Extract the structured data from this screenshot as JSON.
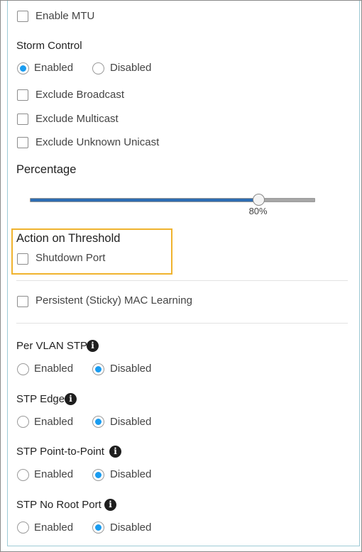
{
  "enable_mtu": {
    "label": "Enable MTU",
    "checked": false
  },
  "storm_control": {
    "title": "Storm Control",
    "enabled_label": "Enabled",
    "disabled_label": "Disabled",
    "selected": "Enabled",
    "exclude_broadcast": "Exclude Broadcast",
    "exclude_multicast": "Exclude Multicast",
    "exclude_unknown_unicast": "Exclude Unknown Unicast"
  },
  "percentage": {
    "title": "Percentage",
    "value": 80,
    "value_label": "80%"
  },
  "action_on_threshold": {
    "title": "Action on Threshold",
    "shutdown_port": "Shutdown Port",
    "highlight_color": "#f0b32e"
  },
  "sticky_mac": {
    "label": "Persistent (Sticky) MAC Learning",
    "checked": false
  },
  "per_vlan_stp": {
    "title": "Per VLAN STP",
    "enabled_label": "Enabled",
    "disabled_label": "Disabled",
    "selected": "Disabled",
    "icon": "info-icon"
  },
  "stp_edge": {
    "title": "STP Edge",
    "enabled_label": "Enabled",
    "disabled_label": "Disabled",
    "selected": "Disabled",
    "icon": "info-icon"
  },
  "stp_point_to_point": {
    "title": "STP Point-to-Point",
    "enabled_label": "Enabled",
    "disabled_label": "Disabled",
    "selected": "Disabled",
    "icon": "info-icon"
  },
  "stp_no_root_port": {
    "title": "STP No Root Port",
    "enabled_label": "Enabled",
    "disabled_label": "Disabled",
    "selected": "Disabled",
    "icon": "info-icon"
  },
  "colors": {
    "radio_selected": "#1a9cf0",
    "slider_fill": "#2d6db3",
    "slider_track": "#a7a7a7"
  }
}
